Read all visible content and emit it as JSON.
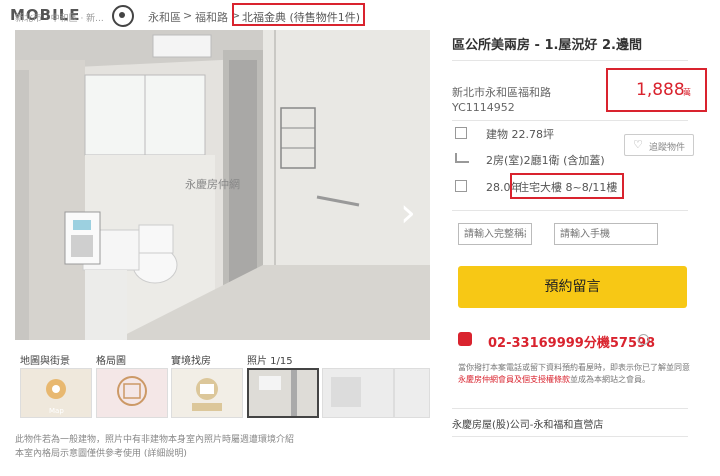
{
  "header": {
    "logo": "MOBILE",
    "crumbs": [
      "新北市",
      "中和區",
      "新..."
    ],
    "crumb_area": "永和區",
    "crumb_sep1": ">",
    "crumb_road": "福和路",
    "crumb_sep2": ">",
    "crumb_current": "北福金典 (待售物件1件)"
  },
  "photo": {
    "watermark": "永慶房仲網",
    "next_arrow": "›"
  },
  "gallery": {
    "tabs": [
      "地圖與街景",
      "格局圖",
      "實境找房",
      "照片 1/15"
    ],
    "map_label": "Map"
  },
  "footnotes": [
    "此物件若為一般建物，照片中有非建物本身室內照片時屬週遭環境介紹",
    "本室內格局示意圖僅供參考使用 (詳細說明)"
  ],
  "listing": {
    "title": "區公所美兩房 - 1.屋況好 2.邊間",
    "address": "新北市永和區福和路",
    "code": "YC1114952",
    "price": "1,888",
    "price_unit": "萬",
    "area": "建物 22.78坪",
    "layout": "2房(室)2廳1衛 (含加蓋)",
    "age": "28.0年",
    "type": "住宅大樓 8~8/11樓",
    "track_label": "追蹤物件"
  },
  "form": {
    "name_placeholder": "請輸入完整稱謂",
    "phone_placeholder": "請輸入手機",
    "book_label": "預約留言"
  },
  "contact": {
    "phone": "02-33169999分機57598",
    "disclaimer_1": "當你撥打本案電話或留下資料預約看屋時，即表示你已了解並同意",
    "disclaimer_link": "永慶房仲網會員及個支授權條款",
    "disclaimer_2": "並成為本網站之會員。",
    "branch": "永慶房屋(股)公司-永和福和直營店"
  },
  "colors": {
    "accent": "#d9232e",
    "button": "#f7c815"
  }
}
